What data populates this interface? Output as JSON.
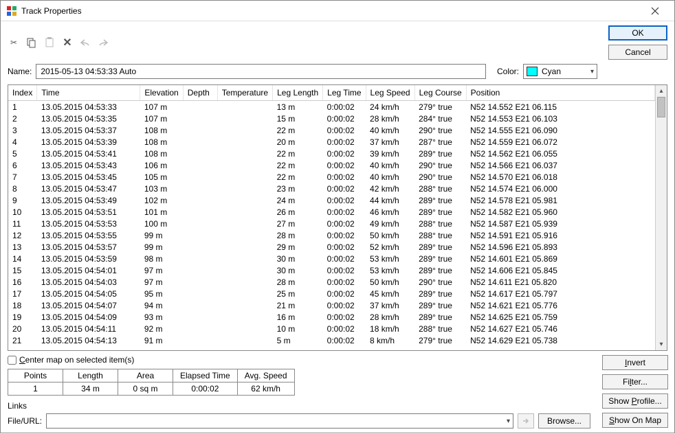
{
  "window": {
    "title": "Track Properties"
  },
  "buttons": {
    "ok": "OK",
    "cancel": "Cancel",
    "invert": "Invert",
    "filter": "Filter...",
    "show_profile": "Show Profile...",
    "show_on_map": "Show On Map",
    "browse": "Browse..."
  },
  "labels": {
    "name": "Name:",
    "color": "Color:",
    "center_map": "Center map on selected item(s)",
    "links": "Links",
    "file_url": "File/URL:"
  },
  "name_value": "2015-05-13 04:53:33 Auto",
  "color_value": "Cyan",
  "color_hex": "#00ffff",
  "columns": [
    "Index",
    "Time",
    "Elevation",
    "Depth",
    "Temperature",
    "Leg Length",
    "Leg Time",
    "Leg Speed",
    "Leg Course",
    "Position"
  ],
  "rows": [
    {
      "index": "1",
      "time": "13.05.2015 04:53:33",
      "elev": "107 m",
      "depth": "",
      "temp": "",
      "leglen": "13 m",
      "legtime": "0:00:02",
      "legspeed": "24 km/h",
      "legcourse": "279° true",
      "pos": "N52 14.552 E21 06.115"
    },
    {
      "index": "2",
      "time": "13.05.2015 04:53:35",
      "elev": "107 m",
      "depth": "",
      "temp": "",
      "leglen": "15 m",
      "legtime": "0:00:02",
      "legspeed": "28 km/h",
      "legcourse": "284° true",
      "pos": "N52 14.553 E21 06.103"
    },
    {
      "index": "3",
      "time": "13.05.2015 04:53:37",
      "elev": "108 m",
      "depth": "",
      "temp": "",
      "leglen": "22 m",
      "legtime": "0:00:02",
      "legspeed": "40 km/h",
      "legcourse": "290° true",
      "pos": "N52 14.555 E21 06.090"
    },
    {
      "index": "4",
      "time": "13.05.2015 04:53:39",
      "elev": "108 m",
      "depth": "",
      "temp": "",
      "leglen": "20 m",
      "legtime": "0:00:02",
      "legspeed": "37 km/h",
      "legcourse": "287° true",
      "pos": "N52 14.559 E21 06.072"
    },
    {
      "index": "5",
      "time": "13.05.2015 04:53:41",
      "elev": "108 m",
      "depth": "",
      "temp": "",
      "leglen": "22 m",
      "legtime": "0:00:02",
      "legspeed": "39 km/h",
      "legcourse": "289° true",
      "pos": "N52 14.562 E21 06.055"
    },
    {
      "index": "6",
      "time": "13.05.2015 04:53:43",
      "elev": "106 m",
      "depth": "",
      "temp": "",
      "leglen": "22 m",
      "legtime": "0:00:02",
      "legspeed": "40 km/h",
      "legcourse": "290° true",
      "pos": "N52 14.566 E21 06.037"
    },
    {
      "index": "7",
      "time": "13.05.2015 04:53:45",
      "elev": "105 m",
      "depth": "",
      "temp": "",
      "leglen": "22 m",
      "legtime": "0:00:02",
      "legspeed": "40 km/h",
      "legcourse": "290° true",
      "pos": "N52 14.570 E21 06.018"
    },
    {
      "index": "8",
      "time": "13.05.2015 04:53:47",
      "elev": "103 m",
      "depth": "",
      "temp": "",
      "leglen": "23 m",
      "legtime": "0:00:02",
      "legspeed": "42 km/h",
      "legcourse": "288° true",
      "pos": "N52 14.574 E21 06.000"
    },
    {
      "index": "9",
      "time": "13.05.2015 04:53:49",
      "elev": "102 m",
      "depth": "",
      "temp": "",
      "leglen": "24 m",
      "legtime": "0:00:02",
      "legspeed": "44 km/h",
      "legcourse": "289° true",
      "pos": "N52 14.578 E21 05.981"
    },
    {
      "index": "10",
      "time": "13.05.2015 04:53:51",
      "elev": "101 m",
      "depth": "",
      "temp": "",
      "leglen": "26 m",
      "legtime": "0:00:02",
      "legspeed": "46 km/h",
      "legcourse": "289° true",
      "pos": "N52 14.582 E21 05.960"
    },
    {
      "index": "11",
      "time": "13.05.2015 04:53:53",
      "elev": "100 m",
      "depth": "",
      "temp": "",
      "leglen": "27 m",
      "legtime": "0:00:02",
      "legspeed": "49 km/h",
      "legcourse": "288° true",
      "pos": "N52 14.587 E21 05.939"
    },
    {
      "index": "12",
      "time": "13.05.2015 04:53:55",
      "elev": "99 m",
      "depth": "",
      "temp": "",
      "leglen": "28 m",
      "legtime": "0:00:02",
      "legspeed": "50 km/h",
      "legcourse": "288° true",
      "pos": "N52 14.591 E21 05.916"
    },
    {
      "index": "13",
      "time": "13.05.2015 04:53:57",
      "elev": "99 m",
      "depth": "",
      "temp": "",
      "leglen": "29 m",
      "legtime": "0:00:02",
      "legspeed": "52 km/h",
      "legcourse": "289° true",
      "pos": "N52 14.596 E21 05.893"
    },
    {
      "index": "14",
      "time": "13.05.2015 04:53:59",
      "elev": "98 m",
      "depth": "",
      "temp": "",
      "leglen": "30 m",
      "legtime": "0:00:02",
      "legspeed": "53 km/h",
      "legcourse": "289° true",
      "pos": "N52 14.601 E21 05.869"
    },
    {
      "index": "15",
      "time": "13.05.2015 04:54:01",
      "elev": "97 m",
      "depth": "",
      "temp": "",
      "leglen": "30 m",
      "legtime": "0:00:02",
      "legspeed": "53 km/h",
      "legcourse": "289° true",
      "pos": "N52 14.606 E21 05.845"
    },
    {
      "index": "16",
      "time": "13.05.2015 04:54:03",
      "elev": "97 m",
      "depth": "",
      "temp": "",
      "leglen": "28 m",
      "legtime": "0:00:02",
      "legspeed": "50 km/h",
      "legcourse": "290° true",
      "pos": "N52 14.611 E21 05.820"
    },
    {
      "index": "17",
      "time": "13.05.2015 04:54:05",
      "elev": "95 m",
      "depth": "",
      "temp": "",
      "leglen": "25 m",
      "legtime": "0:00:02",
      "legspeed": "45 km/h",
      "legcourse": "289° true",
      "pos": "N52 14.617 E21 05.797"
    },
    {
      "index": "18",
      "time": "13.05.2015 04:54:07",
      "elev": "94 m",
      "depth": "",
      "temp": "",
      "leglen": "21 m",
      "legtime": "0:00:02",
      "legspeed": "37 km/h",
      "legcourse": "289° true",
      "pos": "N52 14.621 E21 05.776"
    },
    {
      "index": "19",
      "time": "13.05.2015 04:54:09",
      "elev": "93 m",
      "depth": "",
      "temp": "",
      "leglen": "16 m",
      "legtime": "0:00:02",
      "legspeed": "28 km/h",
      "legcourse": "289° true",
      "pos": "N52 14.625 E21 05.759"
    },
    {
      "index": "20",
      "time": "13.05.2015 04:54:11",
      "elev": "92 m",
      "depth": "",
      "temp": "",
      "leglen": "10 m",
      "legtime": "0:00:02",
      "legspeed": "18 km/h",
      "legcourse": "288° true",
      "pos": "N52 14.627 E21 05.746"
    },
    {
      "index": "21",
      "time": "13.05.2015 04:54:13",
      "elev": "91 m",
      "depth": "",
      "temp": "",
      "leglen": "5 m",
      "legtime": "0:00:02",
      "legspeed": "8 km/h",
      "legcourse": "279° true",
      "pos": "N52 14.629 E21 05.738"
    }
  ],
  "stats": {
    "headers": [
      "Points",
      "Length",
      "Area",
      "Elapsed Time",
      "Avg. Speed"
    ],
    "values": [
      "1",
      "34 m",
      "0 sq m",
      "0:00:02",
      "62 km/h"
    ]
  }
}
